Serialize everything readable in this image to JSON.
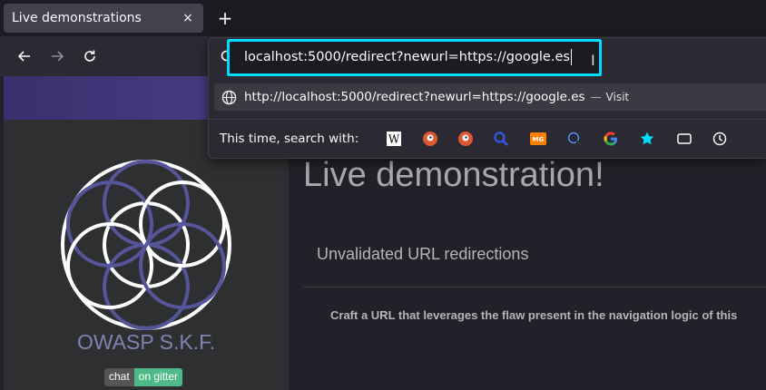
{
  "tab": {
    "title": "Live demonstrations",
    "close_label": "×"
  },
  "newtab": {
    "label": "+"
  },
  "address_bar": {
    "value": "localhost:5000/redirect?newurl=https://google.es",
    "suggestion_url": "http://localhost:5000/redirect?newurl=https://google.es",
    "suggestion_separator": "—",
    "suggestion_action": "Visit"
  },
  "search_with": {
    "label": "This time, search with:",
    "engines": [
      "wikipedia-icon",
      "duckduckgo-icon",
      "duckduckgo-alt-icon",
      "search-engine-icon",
      "metager-icon",
      "qwant-icon",
      "google-icon",
      "bookmarks-icon",
      "tabs-icon",
      "history-icon"
    ]
  },
  "sidebar": {
    "brand": "OWASP S.K.F.",
    "badge_left": "chat",
    "badge_right": "on gitter"
  },
  "main": {
    "title": "Live demonstration!",
    "section_title": "Unvalidated URL redirections",
    "description": "Craft a URL that leverages the flaw present in the navigation logic of this"
  },
  "colors": {
    "focus_ring": "#00ddff",
    "banner": "#4a3f85",
    "logo_purple": "#5a5a9a",
    "badge_green": "#4dba87"
  }
}
